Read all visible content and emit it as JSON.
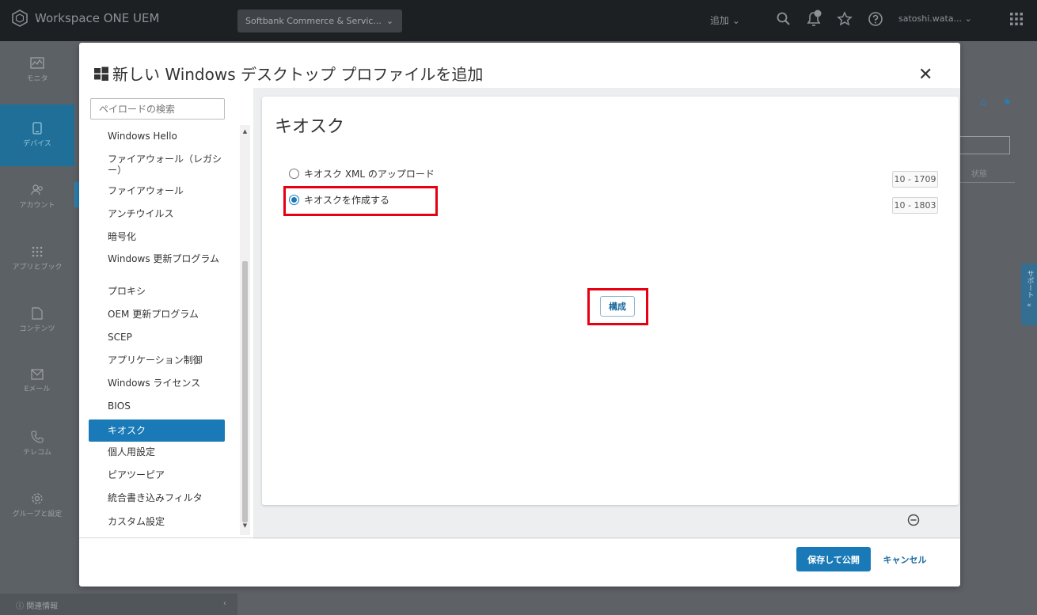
{
  "header": {
    "app_title": "Workspace ONE UEM",
    "org_name": "Softbank Commerce & Servic...",
    "add_label": "追加",
    "notification_count": "",
    "user_name": "satoshi.wata..."
  },
  "leftnav": {
    "items": [
      {
        "label": "モニタ",
        "icon": "monitor-icon"
      },
      {
        "label": "デバイス",
        "icon": "device-icon"
      },
      {
        "label": "アカウント",
        "icon": "accounts-icon"
      },
      {
        "label": "アプリとブック",
        "icon": "apps-icon"
      },
      {
        "label": "コンテンツ",
        "icon": "content-icon"
      },
      {
        "label": "Eメール",
        "icon": "email-icon"
      },
      {
        "label": "テレコム",
        "icon": "telecom-icon"
      },
      {
        "label": "グループと設定",
        "icon": "settings-icon"
      }
    ],
    "footer_label": "関連情報"
  },
  "background": {
    "column_label": "状態",
    "support_label": "サポート"
  },
  "modal": {
    "title": "新しい Windows デスクトップ プロファイルを追加",
    "search_placeholder": "ペイロードの検索",
    "payloads": [
      "Windows Hello",
      "ファイアウォール（レガシー）",
      "ファイアウォール",
      "アンチウイルス",
      "暗号化",
      "Windows 更新プログラム",
      "プロキシ",
      "OEM 更新プログラム",
      "SCEP",
      "アプリケーション制御",
      "Windows ライセンス",
      "BIOS",
      "キオスク",
      "個人用設定",
      "ピアツーピア",
      "統合書き込みフィルタ",
      "カスタム設定"
    ],
    "active_payload": "キオスク",
    "panel": {
      "title": "キオスク",
      "options": [
        {
          "label": "キオスク XML のアップロード",
          "version": "10 - 1709",
          "checked": false
        },
        {
          "label": "キオスクを作成する",
          "version": "10 - 1803",
          "checked": true
        }
      ],
      "configure_label": "構成"
    },
    "footer": {
      "save_label": "保存して公開",
      "cancel_label": "キャンセル"
    }
  },
  "colors": {
    "accent": "#1a7ab8",
    "highlight": "#e60012",
    "header_bg": "#1d2023"
  }
}
